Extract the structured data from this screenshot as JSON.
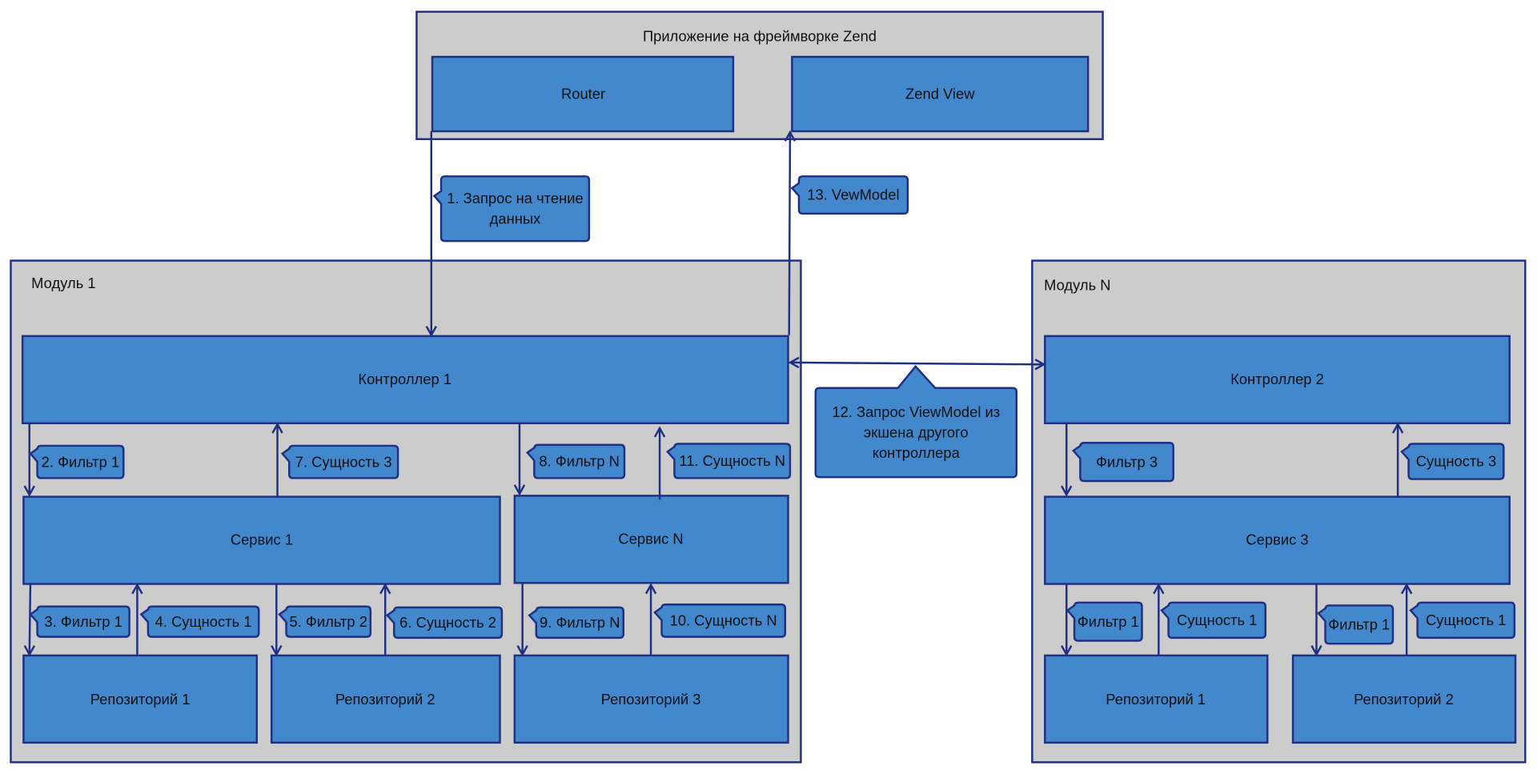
{
  "diagram": {
    "colors": {
      "container_fill": "#cccccc",
      "box_fill": "#4387cd",
      "stroke": "#1f2f82",
      "text": "#111111"
    },
    "framework": {
      "title": "Приложение на фреймворке Zend",
      "router": "Router",
      "zend_view": "Zend View"
    },
    "module1": {
      "title": "Модуль 1",
      "controller": "Контроллер 1",
      "service1": "Сервис 1",
      "serviceN": "Сервис N",
      "repo1": "Репозиторий 1",
      "repo2": "Репозиторий 2",
      "repo3": "Репозиторий 3"
    },
    "moduleN": {
      "title": "Модуль N",
      "controller": "Контроллер 2",
      "service": "Сервис 3",
      "repo1": "Репозиторий 1",
      "repo2": "Репозиторий 2"
    },
    "callouts": {
      "c1": [
        "1. Запрос на чтение",
        "данных"
      ],
      "c13": [
        "13. VewModel"
      ],
      "c12": [
        "12. Запрос ViewModel из",
        "экшена другого",
        "контроллера"
      ],
      "c2": [
        "2. Фильтр 1"
      ],
      "c7": [
        "7. Сущность 3"
      ],
      "c8": [
        "8. Фильтр N"
      ],
      "c11": [
        "11. Сущность N"
      ],
      "c3": [
        "3. Фильтр 1"
      ],
      "c4": [
        "4. Сущность 1"
      ],
      "c5": [
        "5. Фильтр 2"
      ],
      "c6": [
        "6. Сущность 2"
      ],
      "c9": [
        "9. Фильтр N"
      ],
      "c10": [
        "10. Сущность N"
      ],
      "n_filter3": [
        "Фильтр 3"
      ],
      "n_entity3": [
        "Сущность 3"
      ],
      "n_filter1a": [
        "Фильтр 1"
      ],
      "n_entity1a": [
        "Сущность 1"
      ],
      "n_filter1b": [
        "Фильтр 1"
      ],
      "n_entity1b": [
        "Сущность 1"
      ]
    }
  }
}
